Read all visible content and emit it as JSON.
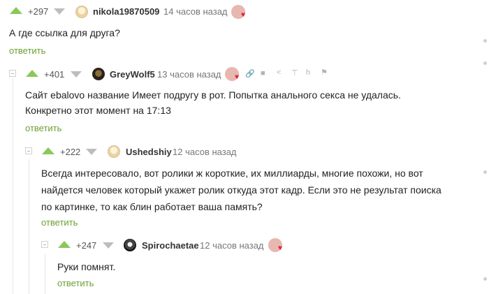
{
  "comments": [
    {
      "rating": "+297",
      "author": "nikola19870509",
      "time": "14 часов назад",
      "text": "А где ссылка для друга?",
      "reply": "ответить"
    },
    {
      "rating": "+401",
      "author": "GreyWolf5",
      "time": "13 часов назад",
      "text_line1": "Сайт ebalovo название Имеет подругу в рот. Попытка анального секса не удалась.",
      "text_line2": "Конкретно этот момент на 17:13",
      "reply": "ответить"
    },
    {
      "rating": "+222",
      "author": "Ushedshiy",
      "time": "12 часов назад",
      "text_line1": "Всегда интересовало, вот ролики ж короткие, их миллиарды, многие похожи, но вот",
      "text_line2": "найдется человек который укажет ролик откуда этот кадр. Если это не результат поиска",
      "text_line3": "по картинке, то как блин работает ваша память?",
      "reply": "ответить"
    },
    {
      "rating": "+247",
      "author": "Spirochaetae",
      "time": "12 часов назад",
      "text": "Руки помнят.",
      "reply": "ответить"
    }
  ],
  "toolbar_icons": [
    "link-icon",
    "save-icon",
    "share-icon",
    "pin-top-icon",
    "branch-icon",
    "flag-icon"
  ],
  "colors": {
    "upvote": "#8ac858",
    "downvote": "#bdbdbd",
    "reply_link": "#6c9f33",
    "heart": "#e0283a"
  }
}
